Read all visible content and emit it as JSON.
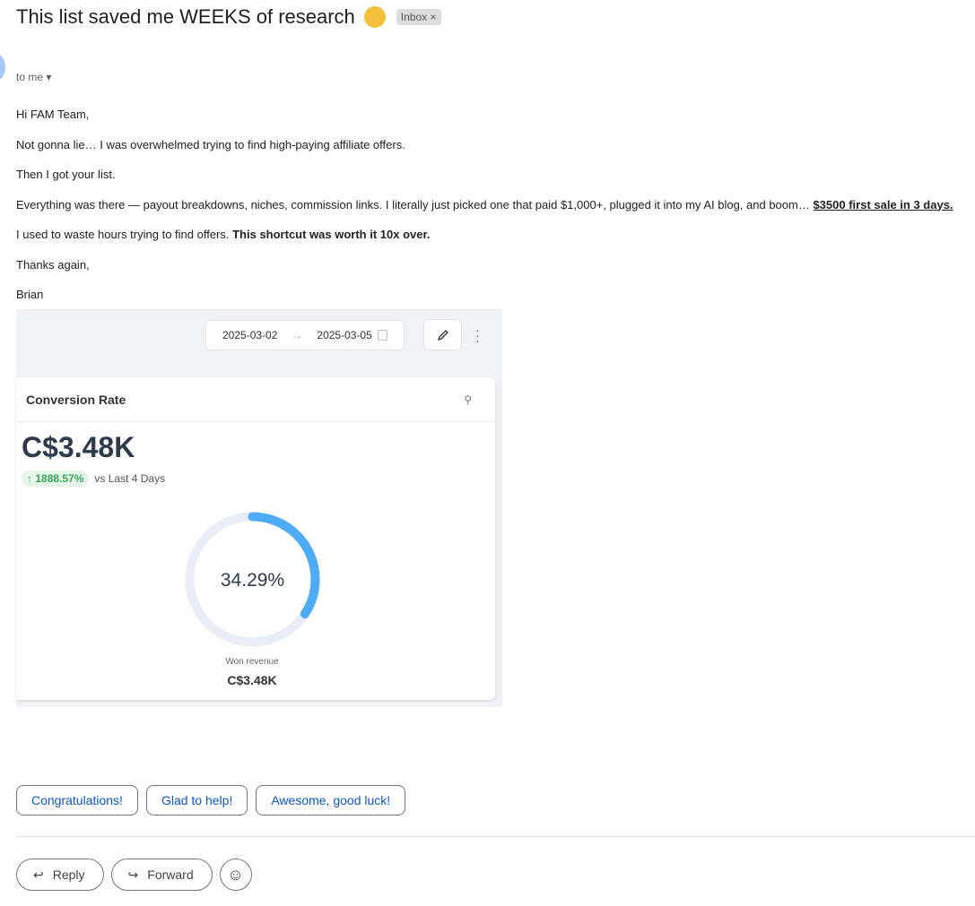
{
  "subject": "This list saved me WEEKS of research",
  "label": "Inbox",
  "recipient": "to me",
  "body": {
    "greeting": "Hi FAM Team,",
    "p1": "Not gonna lie… I was overwhelmed trying to find high-paying affiliate offers.",
    "p2": "Then I got your list.",
    "p3": "Everything was there — payout breakdowns, niches, commission links. I literally just picked one that paid $1,000+, plugged it into my AI blog, and boom… ",
    "p3_bold": "$3500 first sale in 3 days.",
    "p4": "I used to waste hours trying to find offers. ",
    "p4_bold": "This shortcut was worth it 10x over.",
    "thanks": "Thanks again,",
    "signature": "Brian"
  },
  "dashboard": {
    "date_from": "2025-03-02",
    "date_to": "2025-03-05",
    "card_title": "Conversion Rate",
    "value": "C$3.48K",
    "delta": "1888.57%",
    "delta_label": "vs Last 4 Days",
    "donut_percent": 34.29,
    "donut_label": "34.29%",
    "won_label": "Won revenue",
    "won_value": "C$3.48K",
    "colors": {
      "arc": "#4dabf7",
      "track": "#e8edf7"
    }
  },
  "smart_replies": [
    "Congratulations!",
    "Glad to help!",
    "Awesome, good luck!"
  ],
  "actions": {
    "reply": "Reply",
    "forward": "Forward"
  }
}
